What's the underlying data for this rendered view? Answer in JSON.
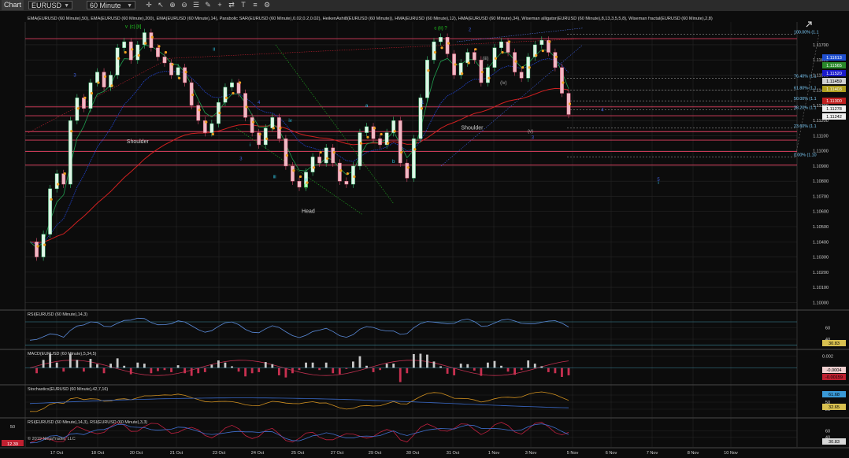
{
  "toolbar": {
    "chart_tab": "Chart",
    "symbol": "EURUSD",
    "interval": "60 Minute",
    "tools": [
      {
        "name": "crosshair-icon",
        "glyph": "✛"
      },
      {
        "name": "pointer-icon",
        "glyph": "↖"
      },
      {
        "name": "zoom-in-icon",
        "glyph": "⊕"
      },
      {
        "name": "zoom-out-icon",
        "glyph": "⊖"
      },
      {
        "name": "properties-icon",
        "glyph": "☰"
      },
      {
        "name": "draw-icon",
        "glyph": "✎"
      },
      {
        "name": "plus-icon",
        "glyph": "+"
      },
      {
        "name": "scroll-icon",
        "glyph": "⇄"
      },
      {
        "name": "text-icon",
        "glyph": "T"
      },
      {
        "name": "chart-style-icon",
        "glyph": "≡"
      },
      {
        "name": "strategy-icon",
        "glyph": "⚙"
      }
    ]
  },
  "indicator_legend": "EMA(EURUSD (60 Minute),50), EMA(EURUSD (60 Minute),200), EMA(EURUSD (60 Minute),14), Parabolic SAR(EURUSD (60 Minute),0.02,0.2,0.02), HeikenAshi8(EURUSD (60 Minute)), HMA(EURUSD (60 Minute),12), HMA(EURUSD (60 Minute),34), Wiseman alligator(EURUSD (60 Minute),8,13,3,5,5,8), Wiseman fractal(EURUSD (60 Minute),2,8)",
  "copyright": "© 2019 NinjaTrader, LLC",
  "colors": {
    "background": "#0c0c0c",
    "grid": "#262626",
    "price_text": "#cfcfcf",
    "sar": "#f0a020",
    "ema200": "#d02020",
    "ema50": "#2040c0",
    "ema14": "#20a050",
    "hlines": "#e04060",
    "fib": "#b0b0b0",
    "wave_green": "#22cc22",
    "wave_cyan": "#30c8e8",
    "wave_blue": "#4060e0"
  },
  "chart_data": [
    {
      "type": "candlestick",
      "title": "",
      "symbol": "EURUSD",
      "interval": "60 Minute",
      "x_tick_labels": [
        "17 Oct",
        "18 Oct",
        "20 Oct",
        "21 Oct",
        "23 Oct",
        "24 Oct",
        "25 Oct",
        "27 Oct",
        "29 Oct",
        "30 Oct",
        "31 Oct",
        "1 Nov",
        "3 Nov",
        "5 Nov",
        "6 Nov",
        "7 Nov",
        "8 Nov",
        "10 Nov"
      ],
      "y_tick_labels": [
        "1.11700",
        "1.11600",
        "1.11500",
        "1.11400",
        "1.11300",
        "1.11200",
        "1.11100",
        "1.11000",
        "1.10900",
        "1.10800",
        "1.10700",
        "1.10600",
        "1.10500",
        "1.10400",
        "1.10300",
        "1.10200",
        "1.10100",
        "1.10000"
      ],
      "ylim": [
        1.0996,
        1.1185
      ],
      "price_path": [
        [
          0,
          1.104
        ],
        [
          3,
          1.103
        ],
        [
          6,
          1.1045
        ],
        [
          9,
          1.1075
        ],
        [
          12,
          1.1085
        ],
        [
          15,
          1.1078
        ],
        [
          18,
          1.112
        ],
        [
          21,
          1.1135
        ],
        [
          24,
          1.1128
        ],
        [
          27,
          1.1145
        ],
        [
          30,
          1.1152
        ],
        [
          33,
          1.1142
        ],
        [
          36,
          1.115
        ],
        [
          39,
          1.1168
        ],
        [
          42,
          1.1172
        ],
        [
          45,
          1.116
        ],
        [
          48,
          1.117
        ],
        [
          51,
          1.1178
        ],
        [
          54,
          1.1168
        ],
        [
          57,
          1.1162
        ],
        [
          60,
          1.1158
        ],
        [
          63,
          1.115
        ],
        [
          66,
          1.1155
        ],
        [
          69,
          1.1145
        ],
        [
          72,
          1.113
        ],
        [
          75,
          1.112
        ],
        [
          78,
          1.1112
        ],
        [
          81,
          1.1118
        ],
        [
          84,
          1.1132
        ],
        [
          87,
          1.1142
        ],
        [
          90,
          1.1145
        ],
        [
          93,
          1.1138
        ],
        [
          96,
          1.1122
        ],
        [
          99,
          1.1112
        ],
        [
          102,
          1.1104
        ],
        [
          105,
          1.1115
        ],
        [
          108,
          1.1122
        ],
        [
          111,
          1.1108
        ],
        [
          114,
          1.109
        ],
        [
          117,
          1.108
        ],
        [
          120,
          1.1076
        ],
        [
          123,
          1.1086
        ],
        [
          126,
          1.1096
        ],
        [
          129,
          1.1092
        ],
        [
          132,
          1.1102
        ],
        [
          135,
          1.1092
        ],
        [
          138,
          1.108
        ],
        [
          141,
          1.1078
        ],
        [
          144,
          1.109
        ],
        [
          147,
          1.1112
        ],
        [
          150,
          1.1116
        ],
        [
          153,
          1.1108
        ],
        [
          156,
          1.1104
        ],
        [
          159,
          1.1112
        ],
        [
          162,
          1.112
        ],
        [
          165,
          1.1092
        ],
        [
          168,
          1.1082
        ],
        [
          171,
          1.1108
        ],
        [
          174,
          1.1135
        ],
        [
          177,
          1.116
        ],
        [
          180,
          1.1172
        ],
        [
          183,
          1.1175
        ],
        [
          186,
          1.1164
        ],
        [
          189,
          1.115
        ],
        [
          192,
          1.1158
        ],
        [
          195,
          1.1165
        ],
        [
          198,
          1.116
        ],
        [
          201,
          1.1145
        ],
        [
          204,
          1.1155
        ],
        [
          207,
          1.1168
        ],
        [
          210,
          1.1172
        ],
        [
          213,
          1.1165
        ],
        [
          216,
          1.1152
        ],
        [
          219,
          1.1148
        ],
        [
          222,
          1.1162
        ],
        [
          225,
          1.117
        ],
        [
          228,
          1.1173
        ],
        [
          231,
          1.1165
        ],
        [
          234,
          1.1155
        ],
        [
          237,
          1.1138
        ],
        [
          240,
          1.1124
        ]
      ],
      "horizontal_levels": [
        1.1174,
        1.1129,
        1.11232,
        1.11127,
        1.11071,
        1.10996,
        1.10906
      ],
      "fib_levels": [
        {
          "label": "100.00% (1.1",
          "value": 1.1177
        },
        {
          "label": "76.40% (1.1",
          "value": 1.1148
        },
        {
          "label": "61.80% (1.1",
          "value": 1.114
        },
        {
          "label": "50.00% (1.1",
          "value": 1.1133
        },
        {
          "label": "38.20% (1.1",
          "value": 1.1127
        },
        {
          "label": "23.60% (1.1",
          "value": 1.1115
        },
        {
          "label": "0.00% (1.10",
          "value": 1.1096
        }
      ],
      "price_badges": [
        {
          "text": "1.11613",
          "color": "#2050d0"
        },
        {
          "text": "1.11565",
          "color": "#2a8a2a"
        },
        {
          "text": "1.11520",
          "color": "#1a1acc"
        },
        {
          "text": "1.11459",
          "color": "#d0d0d0"
        },
        {
          "text": "1.11403",
          "color": "#b0a020"
        },
        {
          "text": "1.11300",
          "color": "#c02020"
        },
        {
          "text": "1.11278",
          "color": "#f0f0f0"
        },
        {
          "text": "1.11242",
          "color": "#f0f0f0"
        }
      ],
      "annotations": [
        {
          "text": "Shoulder",
          "x": 48,
          "y": 1.1105
        },
        {
          "text": "Head",
          "x": 124,
          "y": 1.1059
        },
        {
          "text": "Shoulder",
          "x": 197,
          "y": 1.1114
        },
        {
          "text": "v",
          "x": 43,
          "y": 1.1181,
          "color": "#22cc22"
        },
        {
          "text": "(c) [ii]",
          "x": 47,
          "y": 1.1181,
          "color": "#22cc22"
        },
        {
          "text": "ii",
          "x": 82,
          "y": 1.1166,
          "color": "#30c8e8"
        },
        {
          "text": "iii",
          "x": 109,
          "y": 1.1082,
          "color": "#30c8e8"
        },
        {
          "text": "iv",
          "x": 116,
          "y": 1.1119,
          "color": "#30c8e8"
        },
        {
          "text": "v",
          "x": 123,
          "y": 1.108,
          "color": "#30c8e8"
        },
        {
          "text": "(i)",
          "x": 123,
          "y": 1.1076,
          "color": "#22cc22"
        },
        {
          "text": "a",
          "x": 150,
          "y": 1.1129,
          "color": "#30c8e8"
        },
        {
          "text": "b",
          "x": 162,
          "y": 1.1092,
          "color": "#30c8e8"
        },
        {
          "text": "c (ii) ?",
          "x": 183,
          "y": 1.118,
          "color": "#22cc22"
        },
        {
          "text": "i",
          "x": 98,
          "y": 1.1103,
          "color": "#30c8e8"
        },
        {
          "text": "i",
          "x": 280,
          "y": 1.1078,
          "color": "#30c8e8"
        },
        {
          "text": "3",
          "x": 20,
          "y": 1.1149,
          "color": "#4060e0"
        },
        {
          "text": "3",
          "x": 94,
          "y": 1.1094,
          "color": "#4060e0"
        },
        {
          "text": "4",
          "x": 102,
          "y": 1.1131,
          "color": "#4060e0"
        },
        {
          "text": "4",
          "x": 255,
          "y": 1.1126,
          "color": "#4060e0"
        },
        {
          "text": "5",
          "x": 280,
          "y": 1.108,
          "color": "#4060e0"
        },
        {
          "text": "3",
          "x": 224,
          "y": 1.1108,
          "color": "#4060e0"
        },
        {
          "text": "(v)",
          "x": 223,
          "y": 1.1112,
          "color": "#aaaaaa"
        },
        {
          "text": "(iii)",
          "x": 203,
          "y": 1.116,
          "color": "#aaaaaa"
        },
        {
          "text": "(iv)",
          "x": 211,
          "y": 1.1144,
          "color": "#aaaaaa"
        },
        {
          "text": "1",
          "x": 175,
          "y": 1.1131,
          "color": "#4060e0"
        },
        {
          "text": "2",
          "x": 196,
          "y": 1.1179,
          "color": "#4060e0"
        }
      ]
    },
    {
      "type": "line",
      "title": "RSI(EURUSD (60 Minute),14,3)",
      "y_tick_labels": [
        "60",
        "40"
      ],
      "ylim": [
        25,
        85
      ],
      "levels": [
        70,
        30
      ],
      "last_value": "30.83"
    },
    {
      "type": "bar",
      "title": "MACD(EURUSD (60 Minute),5,34,5)",
      "y_tick_labels": [
        "0.002"
      ],
      "ylim": [
        -0.0026,
        0.0026
      ],
      "last_values": [
        "-0.0004",
        "-0.00159"
      ]
    },
    {
      "type": "line",
      "title": "Stochastics(EURUSD (60 Minute),42,7,16)",
      "y_tick_labels": [
        "75",
        "50",
        "25"
      ],
      "ylim": [
        0,
        100
      ],
      "last_values": [
        "61.68",
        "32.65"
      ]
    },
    {
      "type": "line",
      "title": "RSI(EURUSD (60 Minute),14,3), RSI(EURUSD (60 Minute),3,3)",
      "y_tick_labels": [
        "60",
        "40"
      ],
      "ylim": [
        10,
        90
      ],
      "left_labels": [
        "50",
        "12.39"
      ],
      "last_value": "30.83"
    }
  ]
}
